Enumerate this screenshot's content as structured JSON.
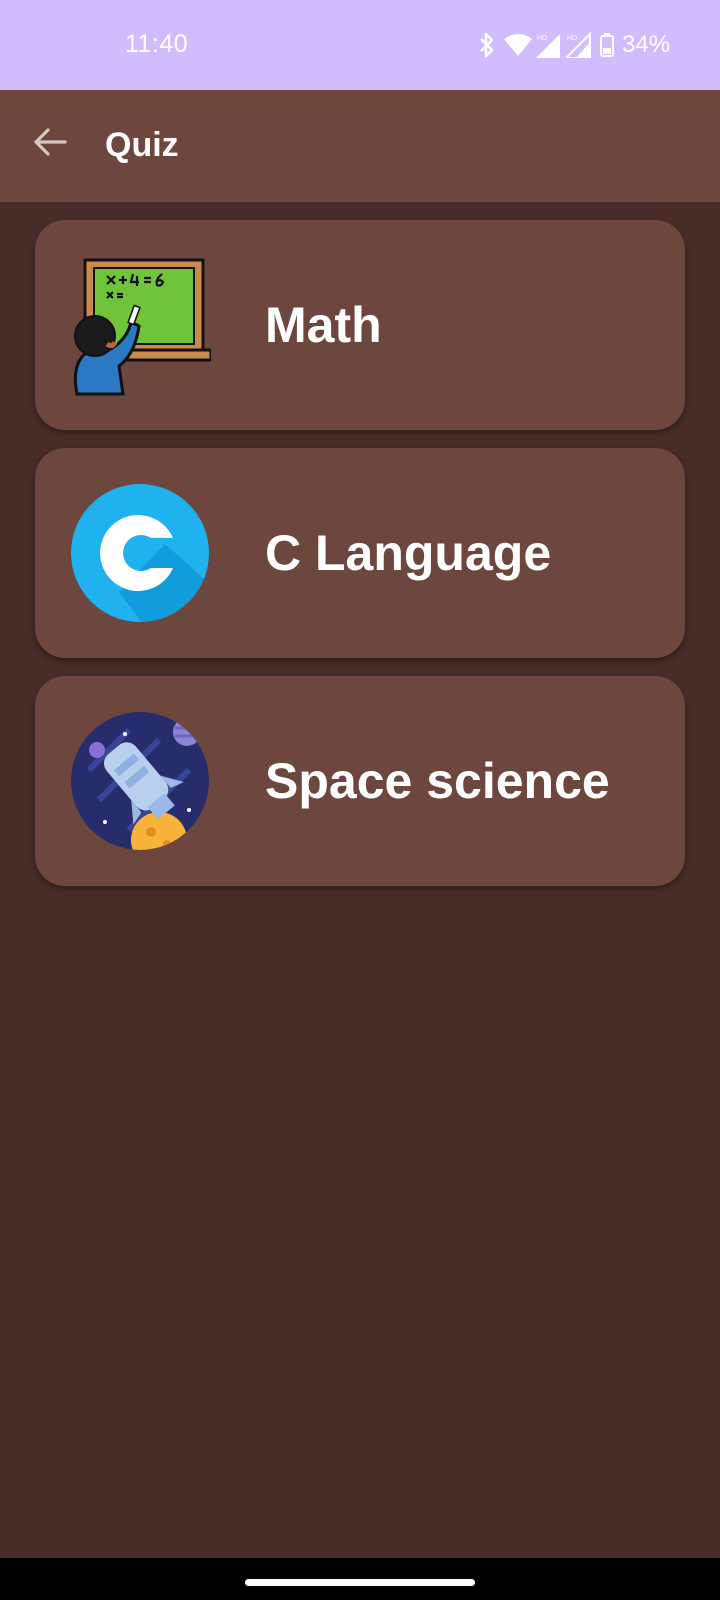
{
  "status_bar": {
    "time": "11:40",
    "battery_percent": "34%",
    "icons": [
      "bluetooth-icon",
      "wifi-icon",
      "signal-hd-icon",
      "signal-hd-icon",
      "battery-icon"
    ]
  },
  "app_bar": {
    "back_icon": "arrow-back-icon",
    "title": "Quiz"
  },
  "quiz_list": {
    "items": [
      {
        "label": "Math",
        "icon": "math-chalkboard-icon"
      },
      {
        "label": "C Language",
        "icon": "c-language-icon"
      },
      {
        "label": "Space science",
        "icon": "space-rocket-icon"
      }
    ]
  },
  "colors": {
    "status_bar_bg": "#d1bdfd",
    "app_bar_bg": "#6d463d",
    "screen_bg": "#472c29",
    "card_bg": "#6d463d",
    "text": "#ffffff"
  }
}
